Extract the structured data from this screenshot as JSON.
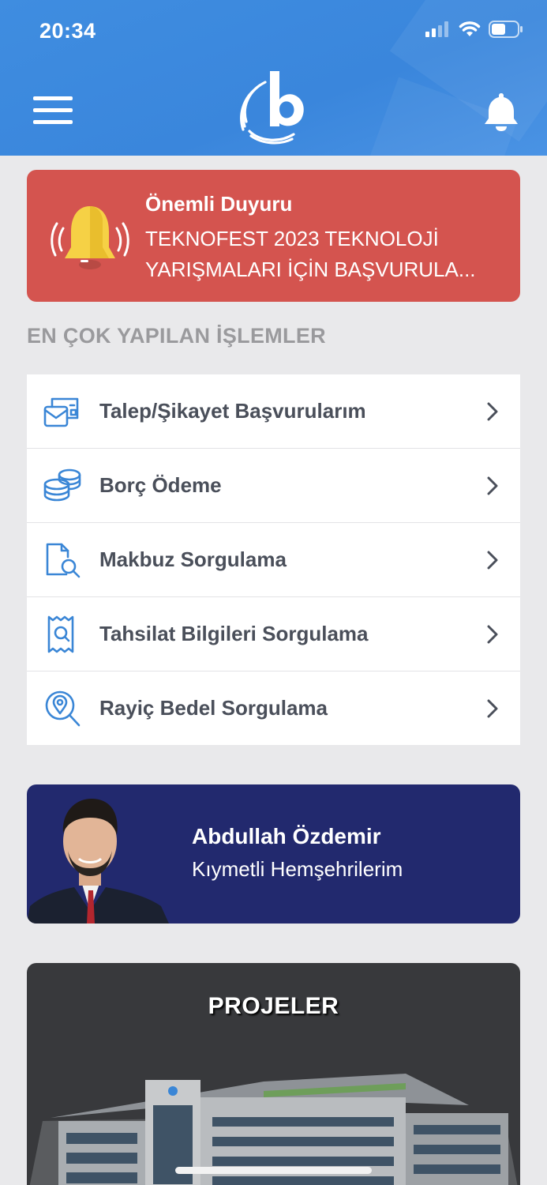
{
  "status_bar": {
    "time": "20:34"
  },
  "announcement": {
    "title": "Önemli Duyuru",
    "line1": "TEKNOFEST 2023 TEKNOLOJİ",
    "line2": "YARIŞMALARI İÇİN BAŞVURULA..."
  },
  "section_title": "EN ÇOK YAPILAN İŞLEMLER",
  "menu_items": [
    {
      "label": "Talep/Şikayet Başvurularım",
      "icon": "mail-form-icon"
    },
    {
      "label": "Borç Ödeme",
      "icon": "coins-icon"
    },
    {
      "label": "Makbuz Sorgulama",
      "icon": "document-search-icon"
    },
    {
      "label": "Tahsilat Bilgileri Sorgulama",
      "icon": "receipt-search-icon"
    },
    {
      "label": "Rayiç Bedel Sorgulama",
      "icon": "location-search-icon"
    }
  ],
  "mayor_card": {
    "name": "Abdullah Özdemir",
    "subtitle": "Kıymetli Hemşehrilerim"
  },
  "projects_card": {
    "title": "PROJELER"
  },
  "colors": {
    "header": "#3f8de0",
    "announcement": "#d4544f",
    "accent_icon": "#3a86d6",
    "mayor_card": "#22296e",
    "projects_card": "#38393c"
  }
}
